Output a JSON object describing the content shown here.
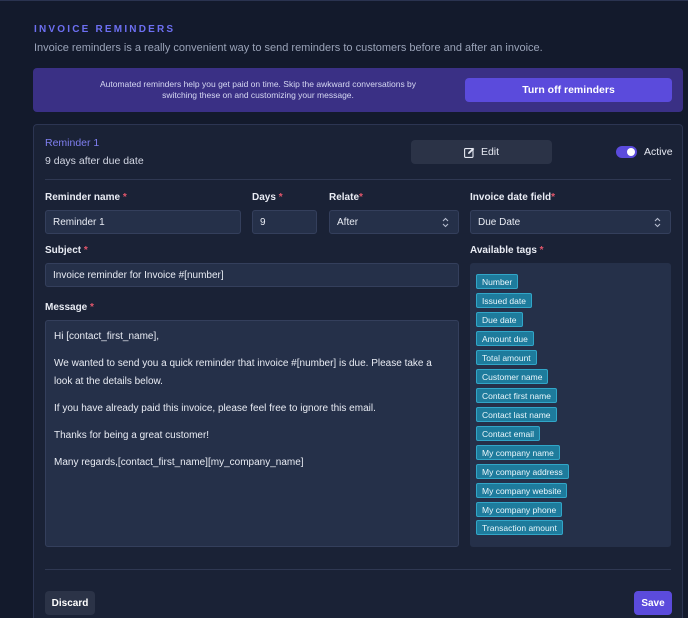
{
  "section": {
    "title": "INVOICE REMINDERS",
    "description": "Invoice reminders is a really convenient way to send reminders to customers before and after an invoice."
  },
  "banner": {
    "text": "Automated reminders help you get paid on time. Skip the awkward conversations by switching these on and customizing your message.",
    "button_label": "Turn off reminders"
  },
  "reminder": {
    "title": "Reminder 1",
    "subtitle": "9 days after due date",
    "edit_label": "Edit",
    "edit_icon": "pencil-square-icon",
    "toggle_on": true,
    "active_label": "Active"
  },
  "form": {
    "name_label": "Reminder name",
    "name_value": "Reminder 1",
    "days_label": "Days",
    "days_value": "9",
    "relate_label": "Relate",
    "relate_value": "After",
    "date_field_label": "Invoice date field",
    "date_field_value": "Due Date",
    "subject_label": "Subject",
    "subject_value": "Invoice reminder for Invoice #[number]",
    "message_label": "Message",
    "message_paragraphs": [
      "Hi [contact_first_name],",
      "We wanted to send you a quick reminder that invoice #[number] is due. Please take a look at the details below.",
      "If you have already paid this invoice, please feel free to ignore this email.",
      "Thanks for being a great customer!",
      "Many regards,[contact_first_name][my_company_name]"
    ],
    "tags_label": "Available tags",
    "tags": [
      "Number",
      "Issued date",
      "Due date",
      "Amount due",
      "Total amount",
      "Customer name",
      "Contact first name",
      "Contact last name",
      "Contact email",
      "My company name",
      "My company address",
      "My company website",
      "My company phone",
      "Transaction amount"
    ],
    "required_mark": "*"
  },
  "footer": {
    "discard_label": "Discard",
    "save_label": "Save"
  },
  "colors": {
    "background": "#131a2c",
    "card": "#1a2236",
    "accent": "#5b4bdc",
    "banner": "#3a3085",
    "tag": "#1e7b9c",
    "required": "#e2566b"
  }
}
